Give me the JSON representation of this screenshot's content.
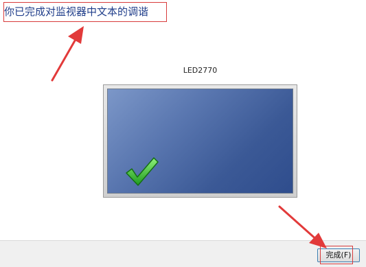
{
  "heading": {
    "text": "你已完成对监视器中文本的调谐"
  },
  "monitor": {
    "label": "LED2770",
    "icon": "checkmark-icon"
  },
  "footer": {
    "finish_label": "完成(F)"
  },
  "colors": {
    "heading": "#1f3d8a",
    "annotation": "#d83b3b",
    "screen_dark": "#2f4d8d",
    "screen_light": "#7c97c8",
    "check_green": "#2fb52f"
  }
}
